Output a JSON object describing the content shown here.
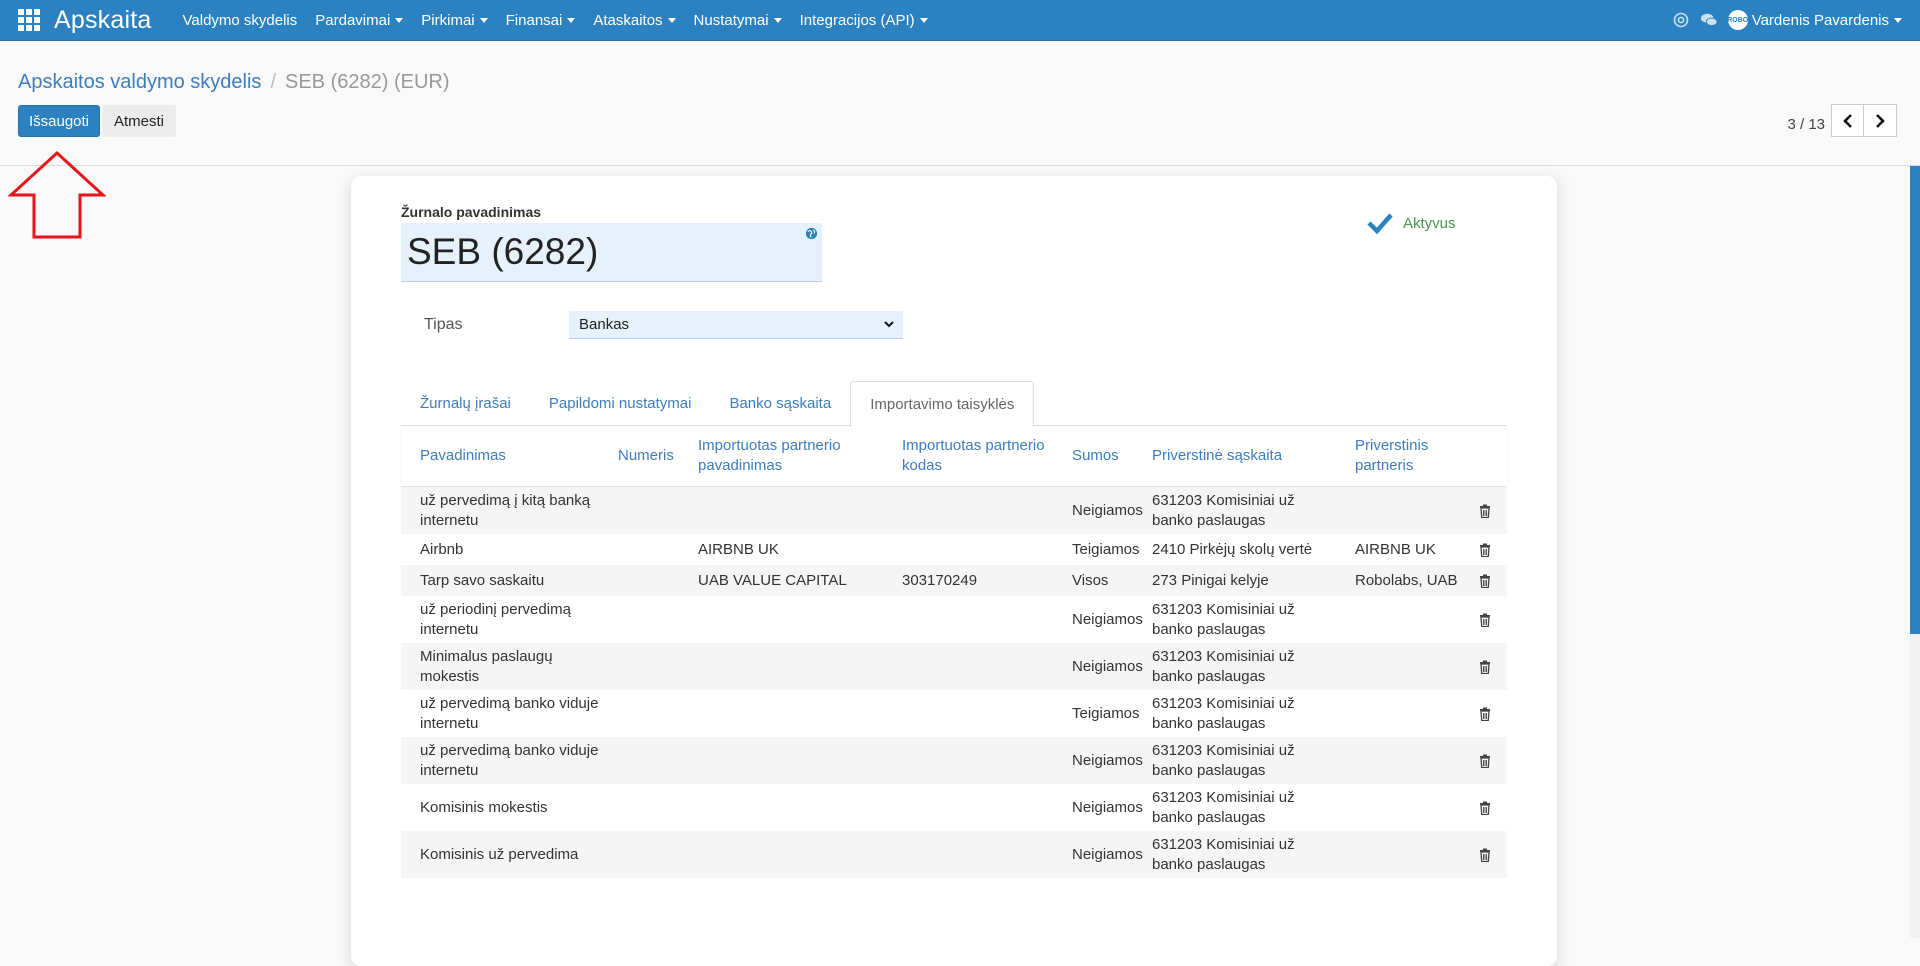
{
  "navbar": {
    "brand": "Apskaita",
    "menu": [
      {
        "label": "Valdymo skydelis",
        "dropdown": false
      },
      {
        "label": "Pardavimai",
        "dropdown": true
      },
      {
        "label": "Pirkimai",
        "dropdown": true
      },
      {
        "label": "Finansai",
        "dropdown": true
      },
      {
        "label": "Ataskaitos",
        "dropdown": true
      },
      {
        "label": "Nustatymai",
        "dropdown": true
      },
      {
        "label": "Integracijos (API)",
        "dropdown": true
      }
    ],
    "avatar_text": "ROBO",
    "user_name": "Vardenis Pavardenis"
  },
  "breadcrumb": {
    "parent": "Apskaitos valdymo skydelis",
    "separator": "/",
    "current": "SEB (6282) (EUR)"
  },
  "buttons": {
    "save": "Išsaugoti",
    "discard": "Atmesti"
  },
  "pager": {
    "value": "3 / 13"
  },
  "form": {
    "name_label": "Žurnalo pavadinimas",
    "name_value": "SEB (6282)",
    "active_label": "Aktyvus",
    "type_label": "Tipas",
    "type_value": "Bankas"
  },
  "tabs": [
    {
      "label": "Žurnalų įrašai",
      "active": false
    },
    {
      "label": "Papildomi nustatymai",
      "active": false
    },
    {
      "label": "Banko sąskaita",
      "active": false
    },
    {
      "label": "Importavimo taisyklės",
      "active": true
    }
  ],
  "table": {
    "columns": [
      "Pavadinimas",
      "Numeris",
      "Importuotas partnerio pavadinimas",
      "Importuotas partnerio kodas",
      "Sumos",
      "Priverstinė sąskaita",
      "Priverstinis partneris"
    ],
    "rows": [
      {
        "name": "už pervedimą į kitą banką internetu",
        "number": "",
        "partner_name": "",
        "partner_code": "",
        "sums": "Neigiamos",
        "account": "631203 Komisiniai už banko paslaugas",
        "partner": ""
      },
      {
        "name": "Airbnb",
        "number": "",
        "partner_name": "AIRBNB UK",
        "partner_code": "",
        "sums": "Teigiamos",
        "account": "2410 Pirkėjų skolų vertė",
        "partner": "AIRBNB UK"
      },
      {
        "name": "Tarp savo saskaitu",
        "number": "",
        "partner_name": "UAB VALUE CAPITAL",
        "partner_code": "303170249",
        "sums": "Visos",
        "account": "273 Pinigai kelyje",
        "partner": "Robolabs, UAB"
      },
      {
        "name": "už periodinį pervedimą internetu",
        "number": "",
        "partner_name": "",
        "partner_code": "",
        "sums": "Neigiamos",
        "account": "631203 Komisiniai už banko paslaugas",
        "partner": ""
      },
      {
        "name": "Minimalus paslaugų mokestis",
        "number": "",
        "partner_name": "",
        "partner_code": "",
        "sums": "Neigiamos",
        "account": "631203 Komisiniai už banko paslaugas",
        "partner": ""
      },
      {
        "name": "už pervedimą banko viduje internetu",
        "number": "",
        "partner_name": "",
        "partner_code": "",
        "sums": "Teigiamos",
        "account": "631203 Komisiniai už banko paslaugas",
        "partner": ""
      },
      {
        "name": "už pervedimą banko viduje internetu",
        "number": "",
        "partner_name": "",
        "partner_code": "",
        "sums": "Neigiamos",
        "account": "631203 Komisiniai už banko paslaugas",
        "partner": ""
      },
      {
        "name": "Komisinis mokestis",
        "number": "",
        "partner_name": "",
        "partner_code": "",
        "sums": "Neigiamos",
        "account": "631203 Komisiniai už banko paslaugas",
        "partner": ""
      },
      {
        "name": "Komisinis už pervedima",
        "number": "",
        "partner_name": "",
        "partner_code": "",
        "sums": "Neigiamos",
        "account": "631203 Komisiniai už banko paslaugas",
        "partner": ""
      }
    ]
  },
  "icons": {
    "apps": "apps-grid-icon",
    "help": "help-icon",
    "chat": "chat-icon",
    "globe": "globe-icon",
    "check": "check-icon",
    "trash": "trash-icon",
    "prev": "chevron-left-icon",
    "next": "chevron-right-icon",
    "annotation": "red-arrow-up-icon"
  },
  "colors": {
    "primary": "#2c82c0",
    "link": "#3c7ebf",
    "active_green": "#4a9a4a",
    "field_bg": "#e6f1fb",
    "annotation_red": "#e8141c"
  }
}
